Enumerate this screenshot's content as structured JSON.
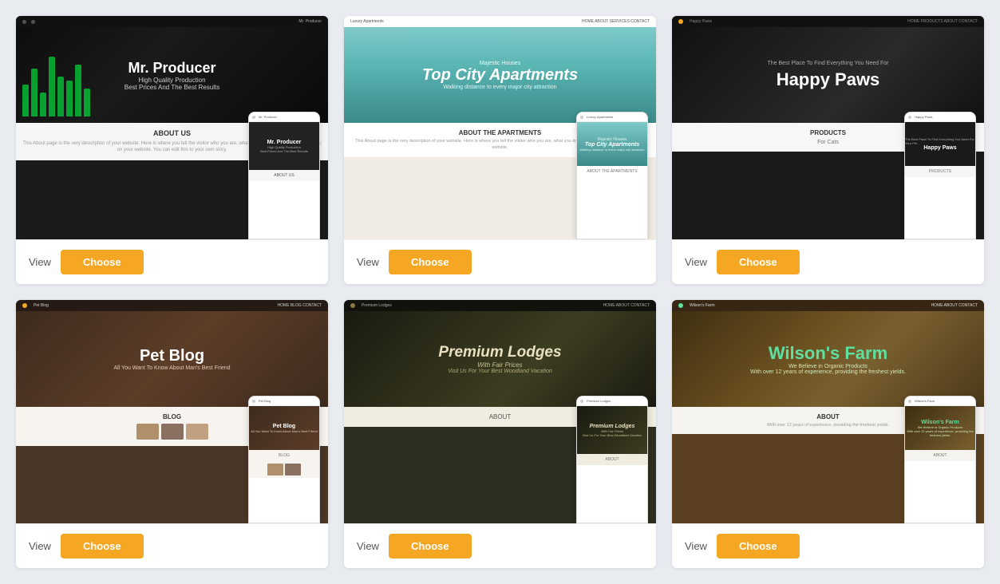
{
  "page": {
    "background": "#e8ecf0"
  },
  "templates": [
    {
      "id": "mr-producer",
      "name": "Mr. Producer",
      "tagline": "High Quality Production",
      "subtitle": "Best Prices And The Best Results",
      "section": "ABOUT US",
      "section_text": "This About page is the very description of your website. Here is where you tell the visitor who you are, what you do, and why they should stay on your website. You can edit this to your own story.",
      "view_label": "View",
      "choose_label": "Choose",
      "mobile_title": "Mr. Producer",
      "mobile_sub": "High Quality Production",
      "mobile_sub2": "Best Prices And The Best Results",
      "mobile_section": "ABOUT US",
      "color_accent": "#00ff44",
      "color_bg": "#1a1a1a"
    },
    {
      "id": "luxury-apartments",
      "name": "Luxury Apartments",
      "hero_small": "Majestic Houses",
      "hero_title": "Top City Apartments",
      "hero_sub": "Walking distance to every major city attraction",
      "section": "ABOUT THE APARTMENTS",
      "section_text": "This About page is the very description of your website. Here is where you tell the visitor who you are, what you do, and why they should stay on your website.",
      "view_label": "View",
      "choose_label": "Choose",
      "mobile_small": "Majestic Houses",
      "mobile_title": "Top City Apartments",
      "mobile_sub": "Walking distance to every major city attraction",
      "mobile_section": "ABOUT THE APARTMENTS"
    },
    {
      "id": "happy-paws",
      "name": "Happy Paws",
      "hero_sub": "The Best Place To Find Everything You Need For",
      "hero_title": "Happy Paws",
      "section": "PRODUCTS",
      "section_sub": "For Cats",
      "view_label": "View",
      "choose_label": "Choose",
      "mobile_sub": "The Best Place To Find Everything You Need For Your Pet",
      "mobile_title": "Happy Paws",
      "mobile_section": "PRODUCTS"
    },
    {
      "id": "pet-blog",
      "name": "Pet Blog",
      "hero_title": "Pet Blog",
      "hero_sub": "All You Want To Know About Man's Best Friend",
      "section": "BLOG",
      "view_label": "View",
      "choose_label": "Choose",
      "mobile_title": "Pet Blog",
      "mobile_sub": "All You Want To Know About Man's Best Friend",
      "mobile_section": "BLOG"
    },
    {
      "id": "premium-lodges",
      "name": "Premium Lodges",
      "hero_title": "Premium Lodges",
      "hero_sub": "With Fair Prices",
      "hero_sub2": "Visit Us For Your Best Woodland Vacation",
      "section": "ABOUT",
      "view_label": "View",
      "choose_label": "Choose",
      "mobile_title": "Premium Lodges",
      "mobile_sub": "With Fair Prices",
      "mobile_sub2": "Visit Us For Your Best Woodland Vacation",
      "mobile_section": "ABOUT"
    },
    {
      "id": "wilsons-farm",
      "name": "Wilson's Farm",
      "hero_title": "Wilson's Farm",
      "hero_sub": "We Believe in Organic Products",
      "hero_sub2": "With over 12 years of experience, providing the freshest yields.",
      "section": "ABOUT",
      "view_label": "View",
      "choose_label": "Choose",
      "mobile_title": "Wilson's Farm",
      "mobile_sub": "We Believe in Organic Products",
      "mobile_sub2": "With over 12 years of experience, providing the freshest yields.",
      "mobile_section": "ABOUT"
    }
  ]
}
